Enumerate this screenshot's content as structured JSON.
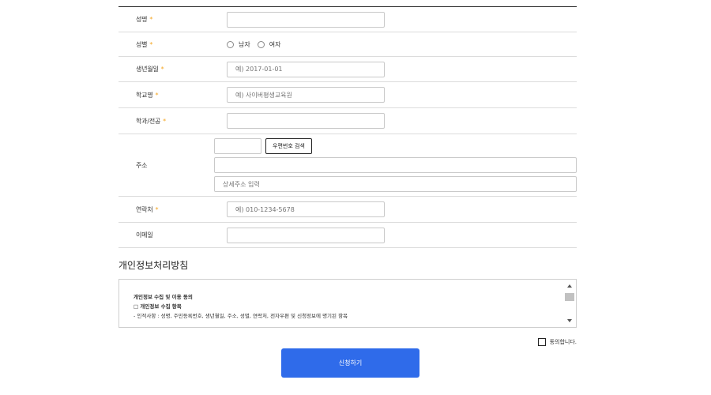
{
  "form": {
    "name": {
      "label": "성명",
      "required": "*"
    },
    "gender": {
      "label": "성별",
      "required": "*",
      "options": [
        "남자",
        "여자"
      ]
    },
    "birth": {
      "label": "생년월일",
      "required": "*",
      "placeholder": "예) 2017-01-01"
    },
    "school": {
      "label": "학교명",
      "required": "*",
      "placeholder": "예) 사이버평생교육원"
    },
    "major": {
      "label": "학과/전공",
      "required": "*"
    },
    "address": {
      "label": "주소",
      "search_button": "우편번호 검색",
      "detail_placeholder": "상세주소 입력"
    },
    "phone": {
      "label": "연락처",
      "required": "*",
      "placeholder": "예) 010-1234-5678"
    },
    "email": {
      "label": "이메일"
    }
  },
  "privacy": {
    "title": "개인정보처리방침",
    "heading": "개인정보 수집 및 이용 동의",
    "subheading": "□ 개인정보 수집 항목",
    "text": "- 인적사항 : 성명, 주민등록번호, 생년월일, 주소, 성별, 연락처, 전자우편 및 신청정보에 명기된 항목"
  },
  "agree": {
    "label": "동의합니다."
  },
  "submit": {
    "label": "신청하기"
  },
  "colors": {
    "accent": "#2f6bea",
    "required": "#f5a623"
  }
}
